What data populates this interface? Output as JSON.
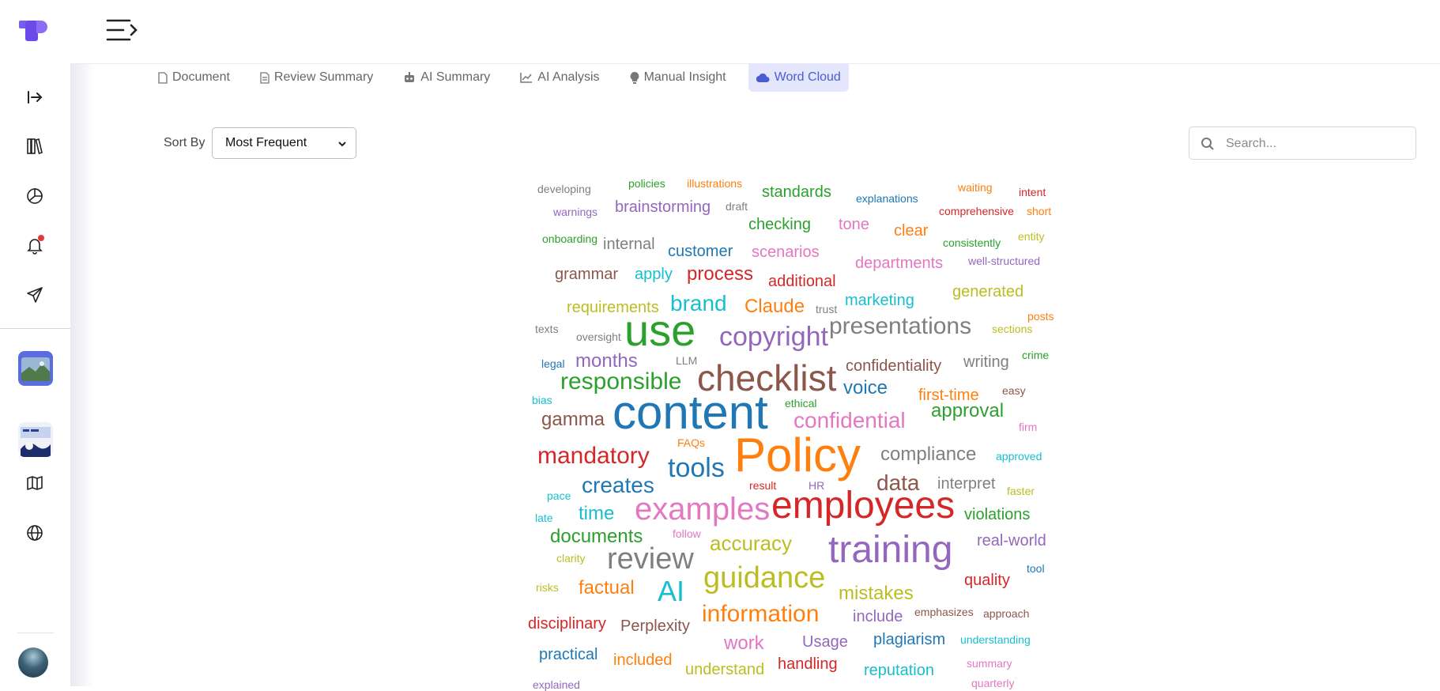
{
  "tabs": [
    {
      "label": "Document",
      "icon": "document-icon",
      "active": false
    },
    {
      "label": "Review Summary",
      "icon": "document-lines-icon",
      "active": false
    },
    {
      "label": "AI Summary",
      "icon": "robot-icon",
      "active": false
    },
    {
      "label": "AI Analysis",
      "icon": "line-chart-icon",
      "active": false
    },
    {
      "label": "Manual Insight",
      "icon": "lightbulb-icon",
      "active": false
    },
    {
      "label": "Word Cloud",
      "icon": "cloud-icon",
      "active": true
    }
  ],
  "sort": {
    "label": "Sort By",
    "value": "Most Frequent"
  },
  "search": {
    "placeholder": "Search..."
  },
  "colors": {
    "accent": "#4a5bd6",
    "active_tab_bg": "#e4e7fb",
    "notification": "#e53935"
  },
  "word_cloud": [
    {
      "t": "developing",
      "c": "#7f7f7f"
    },
    {
      "t": "policies",
      "c": "#2ca02c"
    },
    {
      "t": "illustrations",
      "c": "#ff7f0e"
    },
    {
      "t": "standards",
      "c": "#2ca02c"
    },
    {
      "t": "explanations",
      "c": "#1f77b4"
    },
    {
      "t": "waiting",
      "c": "#ff7f0e"
    },
    {
      "t": "intent",
      "c": "#d62728"
    },
    {
      "t": "warnings",
      "c": "#9467bd"
    },
    {
      "t": "brainstorming",
      "c": "#9467bd"
    },
    {
      "t": "draft",
      "c": "#7f7f7f"
    },
    {
      "t": "comprehensive",
      "c": "#d62728"
    },
    {
      "t": "short",
      "c": "#ff7f0e"
    },
    {
      "t": "checking",
      "c": "#2ca02c"
    },
    {
      "t": "tone",
      "c": "#e377c2"
    },
    {
      "t": "clear",
      "c": "#ff7f0e"
    },
    {
      "t": "onboarding",
      "c": "#2ca02c"
    },
    {
      "t": "internal",
      "c": "#7f7f7f"
    },
    {
      "t": "customer",
      "c": "#1f77b4"
    },
    {
      "t": "scenarios",
      "c": "#e377c2"
    },
    {
      "t": "consistently",
      "c": "#2ca02c"
    },
    {
      "t": "entity",
      "c": "#bcbd22"
    },
    {
      "t": "departments",
      "c": "#e377c2"
    },
    {
      "t": "well-structured",
      "c": "#9467bd"
    },
    {
      "t": "grammar",
      "c": "#8c564b"
    },
    {
      "t": "apply",
      "c": "#17becf"
    },
    {
      "t": "process",
      "c": "#d62728"
    },
    {
      "t": "additional",
      "c": "#d62728"
    },
    {
      "t": "generated",
      "c": "#bcbd22"
    },
    {
      "t": "requirements",
      "c": "#bcbd22"
    },
    {
      "t": "brand",
      "c": "#17becf"
    },
    {
      "t": "Claude",
      "c": "#ff7f0e"
    },
    {
      "t": "trust",
      "c": "#7f7f7f"
    },
    {
      "t": "marketing",
      "c": "#17becf"
    },
    {
      "t": "posts",
      "c": "#ff7f0e"
    },
    {
      "t": "texts",
      "c": "#7f7f7f"
    },
    {
      "t": "use",
      "c": "#2ca02c"
    },
    {
      "t": "oversight",
      "c": "#7f7f7f"
    },
    {
      "t": "copyright",
      "c": "#9467bd"
    },
    {
      "t": "presentations",
      "c": "#7f7f7f"
    },
    {
      "t": "sections",
      "c": "#bcbd22"
    },
    {
      "t": "legal",
      "c": "#1f77b4"
    },
    {
      "t": "months",
      "c": "#9467bd"
    },
    {
      "t": "LLM",
      "c": "#7f7f7f"
    },
    {
      "t": "confidentiality",
      "c": "#8c564b"
    },
    {
      "t": "writing",
      "c": "#7f7f7f"
    },
    {
      "t": "crime",
      "c": "#2ca02c"
    },
    {
      "t": "responsible",
      "c": "#2ca02c"
    },
    {
      "t": "checklist",
      "c": "#8c564b"
    },
    {
      "t": "voice",
      "c": "#1f77b4"
    },
    {
      "t": "first-time",
      "c": "#ff7f0e"
    },
    {
      "t": "easy",
      "c": "#8c564b"
    },
    {
      "t": "bias",
      "c": "#17becf"
    },
    {
      "t": "ethical",
      "c": "#2ca02c"
    },
    {
      "t": "content",
      "c": "#1f77b4"
    },
    {
      "t": "approval",
      "c": "#2ca02c"
    },
    {
      "t": "gamma",
      "c": "#8c564b"
    },
    {
      "t": "confidential",
      "c": "#e377c2"
    },
    {
      "t": "firm",
      "c": "#e377c2"
    },
    {
      "t": "mandatory",
      "c": "#d62728"
    },
    {
      "t": "FAQs",
      "c": "#ff7f0e"
    },
    {
      "t": "Policy",
      "c": "#ff7f0e"
    },
    {
      "t": "compliance",
      "c": "#7f7f7f"
    },
    {
      "t": "approved",
      "c": "#17becf"
    },
    {
      "t": "tools",
      "c": "#1f77b4"
    },
    {
      "t": "creates",
      "c": "#1f77b4"
    },
    {
      "t": "result",
      "c": "#d62728"
    },
    {
      "t": "HR",
      "c": "#9467bd"
    },
    {
      "t": "data",
      "c": "#8c564b"
    },
    {
      "t": "interpret",
      "c": "#7f7f7f"
    },
    {
      "t": "faster",
      "c": "#bcbd22"
    },
    {
      "t": "pace",
      "c": "#17becf"
    },
    {
      "t": "employees",
      "c": "#d62728"
    },
    {
      "t": "late",
      "c": "#17becf"
    },
    {
      "t": "time",
      "c": "#17becf"
    },
    {
      "t": "examples",
      "c": "#e377c2"
    },
    {
      "t": "violations",
      "c": "#2ca02c"
    },
    {
      "t": "documents",
      "c": "#2ca02c"
    },
    {
      "t": "follow",
      "c": "#e377c2"
    },
    {
      "t": "accuracy",
      "c": "#bcbd22"
    },
    {
      "t": "real-world",
      "c": "#9467bd"
    },
    {
      "t": "clarity",
      "c": "#bcbd22"
    },
    {
      "t": "review",
      "c": "#7f7f7f"
    },
    {
      "t": "training",
      "c": "#9467bd"
    },
    {
      "t": "tool",
      "c": "#1f77b4"
    },
    {
      "t": "guidance",
      "c": "#bcbd22"
    },
    {
      "t": "risks",
      "c": "#bcbd22"
    },
    {
      "t": "factual",
      "c": "#ff7f0e"
    },
    {
      "t": "AI",
      "c": "#17becf"
    },
    {
      "t": "quality",
      "c": "#d62728"
    },
    {
      "t": "mistakes",
      "c": "#bcbd22"
    },
    {
      "t": "information",
      "c": "#ff7f0e"
    },
    {
      "t": "disciplinary",
      "c": "#d62728"
    },
    {
      "t": "include",
      "c": "#9467bd"
    },
    {
      "t": "emphasizes",
      "c": "#8c564b"
    },
    {
      "t": "approach",
      "c": "#8c564b"
    },
    {
      "t": "Perplexity",
      "c": "#8c564b"
    },
    {
      "t": "work",
      "c": "#e377c2"
    },
    {
      "t": "Usage",
      "c": "#9467bd"
    },
    {
      "t": "plagiarism",
      "c": "#1f77b4"
    },
    {
      "t": "understanding",
      "c": "#17becf"
    },
    {
      "t": "practical",
      "c": "#1f77b4"
    },
    {
      "t": "included",
      "c": "#ff7f0e"
    },
    {
      "t": "handling",
      "c": "#d62728"
    },
    {
      "t": "summary",
      "c": "#e377c2"
    },
    {
      "t": "understand",
      "c": "#bcbd22"
    },
    {
      "t": "reputation",
      "c": "#17becf"
    },
    {
      "t": "explained",
      "c": "#9467bd"
    },
    {
      "t": "quarterly",
      "c": "#e377c2"
    }
  ]
}
